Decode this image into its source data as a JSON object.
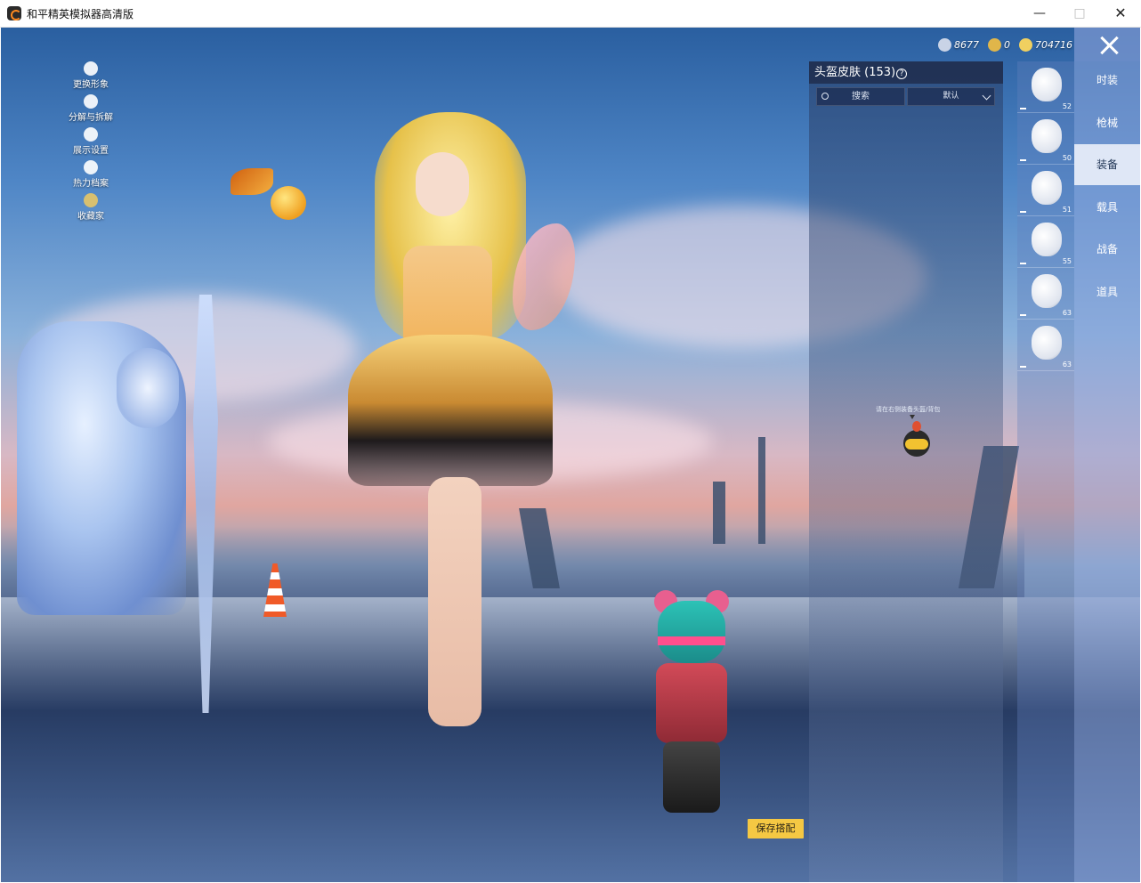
{
  "window": {
    "title": "和平精英模拟器高清版",
    "minimize": "—",
    "maximize": "□",
    "close": "✕"
  },
  "left_menu": [
    {
      "label": "更换形象",
      "icon": "person-icon"
    },
    {
      "label": "分解与拆解",
      "icon": "puzzle-icon"
    },
    {
      "label": "展示设置",
      "icon": "eye-icon"
    },
    {
      "label": "热力档案",
      "icon": "flame-icon"
    },
    {
      "label": "收藏家",
      "icon": "badge-icon"
    }
  ],
  "currency": [
    {
      "value": "8677",
      "color": "#c9d3e6"
    },
    {
      "value": "0",
      "color": "#e0b64a"
    },
    {
      "value": "704716",
      "color": "#f0d060"
    }
  ],
  "skin_panel": {
    "title": "头盔皮肤 (153)",
    "search_placeholder": "搜索",
    "sort_value": "默认",
    "hint": "请在右侧装备头盔/背包"
  },
  "helmets": [
    {
      "level": "52"
    },
    {
      "level": "50"
    },
    {
      "level": "51"
    },
    {
      "level": "55"
    },
    {
      "level": "63"
    },
    {
      "level": "63"
    }
  ],
  "categories": [
    {
      "label": "时装",
      "active": false
    },
    {
      "label": "枪械",
      "active": false
    },
    {
      "label": "装备",
      "active": true
    },
    {
      "label": "载具",
      "active": false
    },
    {
      "label": "战备",
      "active": false
    },
    {
      "label": "道具",
      "active": false
    }
  ],
  "save_button": "保存搭配"
}
